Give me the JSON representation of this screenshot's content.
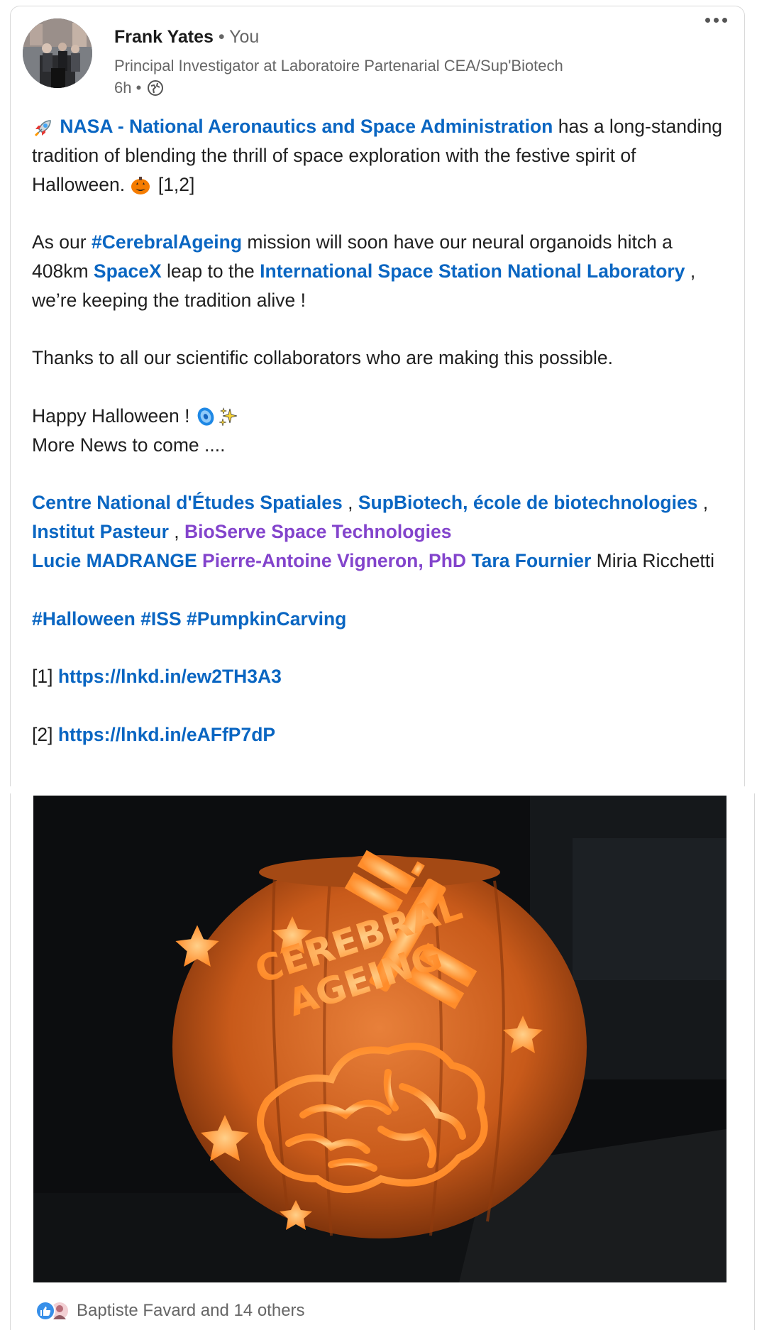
{
  "author": {
    "name": "Frank Yates",
    "relation": " • You",
    "headline": "Principal Investigator at Laboratoire Partenarial CEA/Sup'Biotech",
    "time": "6h •",
    "visibility_icon": "globe-icon"
  },
  "menu": {
    "icon": "more-options-icon"
  },
  "post": {
    "p1": {
      "emoji": "rocket",
      "mention": "NASA - National Aeronautics and Space Administration",
      "text": " has a long-standing tradition of blending the thrill of space exploration with the festive spirit of Halloween. ",
      "emoji2": "pumpkin",
      "ref": " [1,2]"
    },
    "p2": {
      "pre": "As our ",
      "hashtag": "#CerebralAgeing",
      "mid": " mission will soon have our neural organoids hitch a 408km ",
      "mention1": "SpaceX",
      "mid2": " leap to the ",
      "mention2": "International Space Station National Laboratory",
      "post": " , we’re keeping the tradition alive !"
    },
    "p3": "Thanks to all our scientific collaborators who are making this possible.",
    "p4": {
      "line1": "Happy Halloween ! ",
      "emoji": "brain-organoid",
      "emoji2": "sparkles",
      "line2": "More News to come ...."
    },
    "p5": {
      "m1": "Centre National d'Études Spatiales",
      "sep1": " , ",
      "m2": "SupBiotech, école de biotechnologies",
      "sep2": " , ",
      "m3": "Institut Pasteur",
      "sep3": " , ",
      "m4": "BioServe Space Technologies",
      "m5": "Lucie MADRANGE",
      "m6": "Pierre-Antoine Vigneron, PhD",
      "m7": "Tara Fournier",
      "tail": " Miria Ricchetti"
    },
    "hashtags": [
      "#Halloween",
      "#ISS",
      "#PumpkinCarving"
    ],
    "refs": [
      {
        "label": "[1] ",
        "url": "https://lnkd.in/ew2TH3A3"
      },
      {
        "label": "[2] ",
        "url": "https://lnkd.in/eAFfP7dP"
      }
    ]
  },
  "image": {
    "subject": "carved-pumpkin-photo",
    "carving_text_line1": "CEREBRAL",
    "carving_text_line2": "AGEING"
  },
  "reactions": {
    "icons": [
      "like-reaction-icon",
      "profile-avatar-icon"
    ],
    "text": "Baptiste Favard and 14 others"
  },
  "colors": {
    "link": "#0a66c2",
    "mention_purple": "#8344cc",
    "muted": "#666666"
  }
}
